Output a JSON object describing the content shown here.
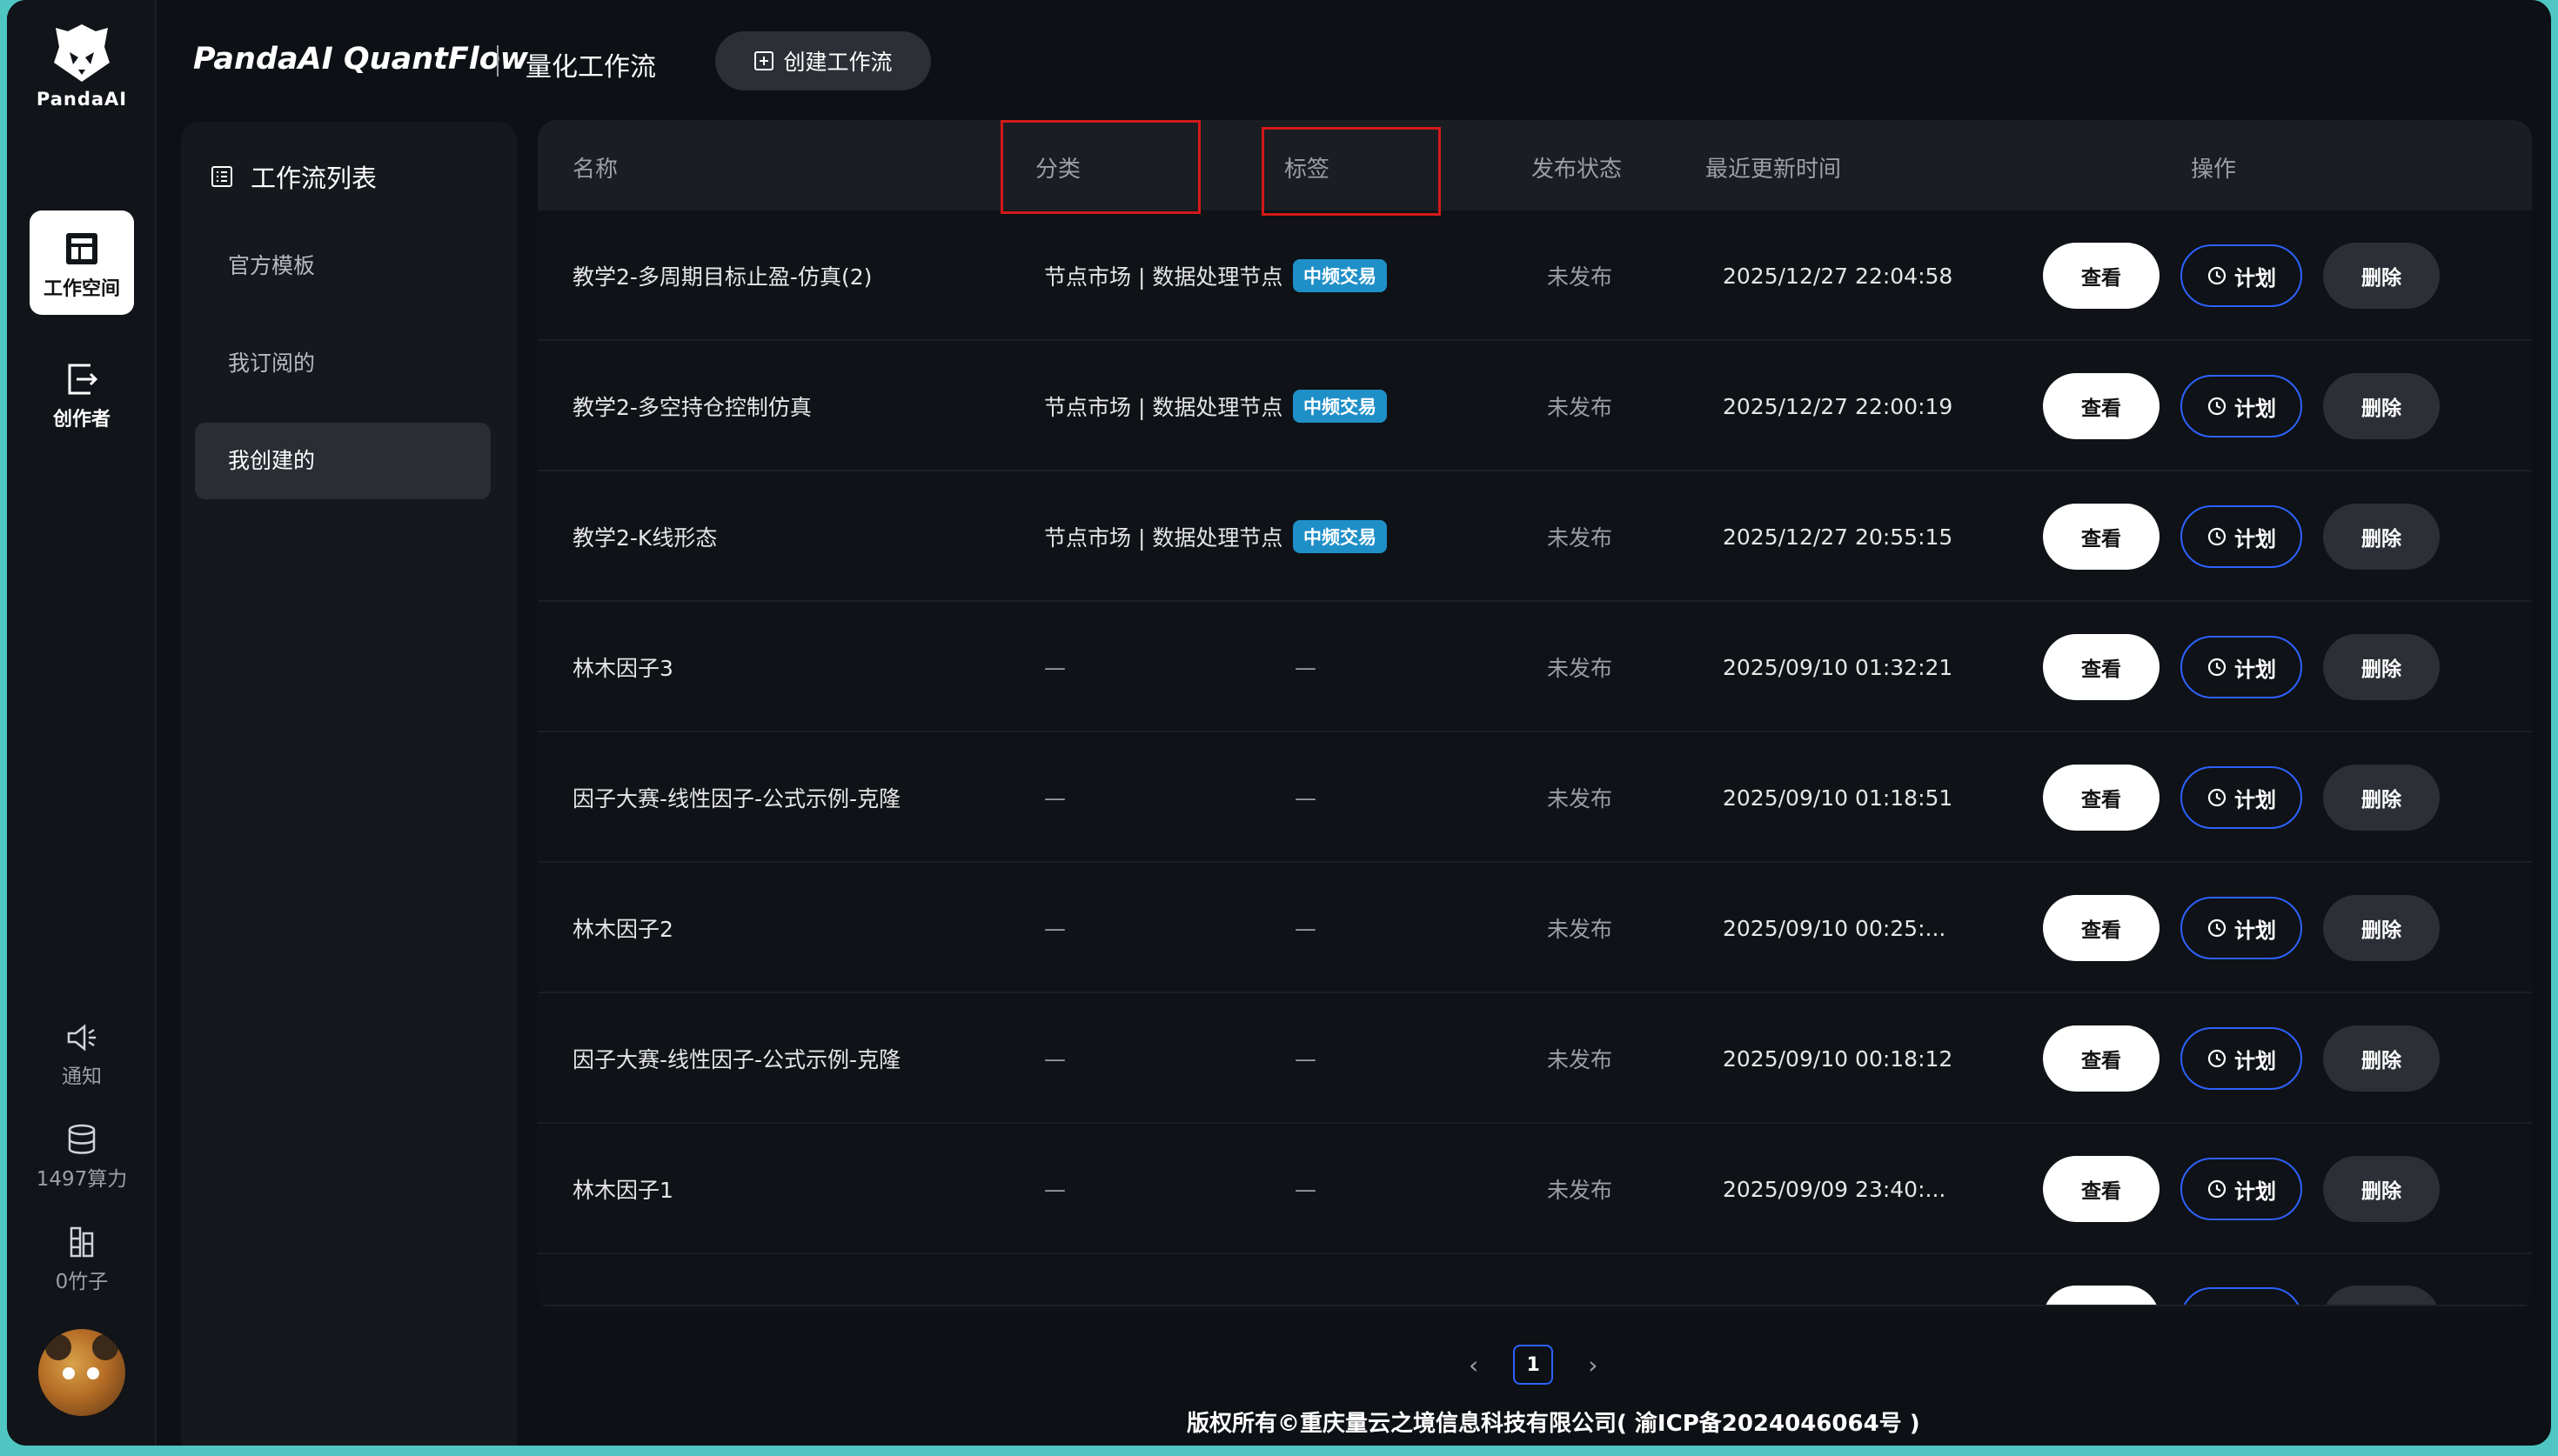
{
  "rail": {
    "logo_text": "PandaAI",
    "workspace_label": "工作空间",
    "creator_label": "创作者",
    "notify_label": "通知",
    "compute_label": "1497算力",
    "bamboo_label": "0竹子"
  },
  "header": {
    "brand": "PandaAI QuantFlow",
    "subtitle": "量化工作流",
    "create_label": "创建工作流"
  },
  "sidenav": {
    "title": "工作流列表",
    "items": [
      {
        "label": "官方模板"
      },
      {
        "label": "我订阅的"
      },
      {
        "label": "我创建的"
      }
    ]
  },
  "table": {
    "columns": {
      "name": "名称",
      "category": "分类",
      "tags": "标签",
      "status": "发布状态",
      "updated": "最近更新时间",
      "actions": "操作"
    },
    "actions": {
      "view": "查看",
      "plan": "计划",
      "delete": "删除"
    },
    "rows": [
      {
        "name": "教学2-多周期目标止盈-仿真(2)",
        "category": "节点市场 | 数据处理节点",
        "tag": "中频交易",
        "status": "未发布",
        "updated": "2025/12/27 22:04:58"
      },
      {
        "name": "教学2-多空持仓控制仿真",
        "category": "节点市场 | 数据处理节点",
        "tag": "中频交易",
        "status": "未发布",
        "updated": "2025/12/27 22:00:19"
      },
      {
        "name": "教学2-K线形态",
        "category": "节点市场 | 数据处理节点",
        "tag": "中频交易",
        "status": "未发布",
        "updated": "2025/12/27 20:55:15"
      },
      {
        "name": "林木因子3",
        "category": "—",
        "tag": "—",
        "status": "未发布",
        "updated": "2025/09/10 01:32:21"
      },
      {
        "name": "因子大赛-线性因子-公式示例-克隆",
        "category": "—",
        "tag": "—",
        "status": "未发布",
        "updated": "2025/09/10 01:18:51"
      },
      {
        "name": "林木因子2",
        "category": "—",
        "tag": "—",
        "status": "未发布",
        "updated": "2025/09/10 00:25:..."
      },
      {
        "name": "因子大赛-线性因子-公式示例-克隆",
        "category": "—",
        "tag": "—",
        "status": "未发布",
        "updated": "2025/09/10 00:18:12"
      },
      {
        "name": "林木因子1",
        "category": "—",
        "tag": "—",
        "status": "未发布",
        "updated": "2025/09/09 23:40:..."
      }
    ]
  },
  "pager": {
    "current": "1"
  },
  "footer": "版权所有©重庆量云之境信息科技有限公司( 渝ICP备2024046064号 )"
}
